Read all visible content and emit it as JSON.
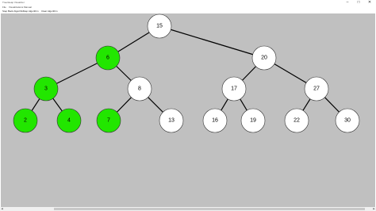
{
  "window": {
    "title": "Tree/Heap Visualizer",
    "minimize_glyph": "–",
    "maximize_glyph": "□",
    "close_glyph": "✕"
  },
  "menu": {
    "items": [
      "File",
      "Visualizations",
      "Manual"
    ]
  },
  "toolbar": {
    "buttons": [
      "Step Back Algorithm",
      "Step Algorithm",
      "Clear Algorithm"
    ]
  },
  "tree": {
    "highlight_color": "#22e600",
    "default_color": "#ffffff",
    "nodes": [
      {
        "id": "n15",
        "value": "15",
        "highlighted": false
      },
      {
        "id": "n6",
        "value": "6",
        "highlighted": true
      },
      {
        "id": "n20",
        "value": "20",
        "highlighted": false
      },
      {
        "id": "n3",
        "value": "3",
        "highlighted": true
      },
      {
        "id": "n8",
        "value": "8",
        "highlighted": false
      },
      {
        "id": "n17",
        "value": "17",
        "highlighted": false
      },
      {
        "id": "n27",
        "value": "27",
        "highlighted": false
      },
      {
        "id": "n2",
        "value": "2",
        "highlighted": true
      },
      {
        "id": "n4",
        "value": "4",
        "highlighted": true
      },
      {
        "id": "n7",
        "value": "7",
        "highlighted": true
      },
      {
        "id": "n13",
        "value": "13",
        "highlighted": false
      },
      {
        "id": "n16",
        "value": "16",
        "highlighted": false
      },
      {
        "id": "n19",
        "value": "19",
        "highlighted": false
      },
      {
        "id": "n22",
        "value": "22",
        "highlighted": false
      },
      {
        "id": "n30",
        "value": "30",
        "highlighted": false
      }
    ],
    "edges": [
      [
        "n15",
        "n6"
      ],
      [
        "n15",
        "n20"
      ],
      [
        "n6",
        "n3"
      ],
      [
        "n6",
        "n8"
      ],
      [
        "n20",
        "n17"
      ],
      [
        "n20",
        "n27"
      ],
      [
        "n3",
        "n2"
      ],
      [
        "n3",
        "n4"
      ],
      [
        "n8",
        "n7"
      ],
      [
        "n8",
        "n13"
      ],
      [
        "n17",
        "n16"
      ],
      [
        "n17",
        "n19"
      ],
      [
        "n27",
        "n22"
      ],
      [
        "n27",
        "n30"
      ]
    ]
  }
}
